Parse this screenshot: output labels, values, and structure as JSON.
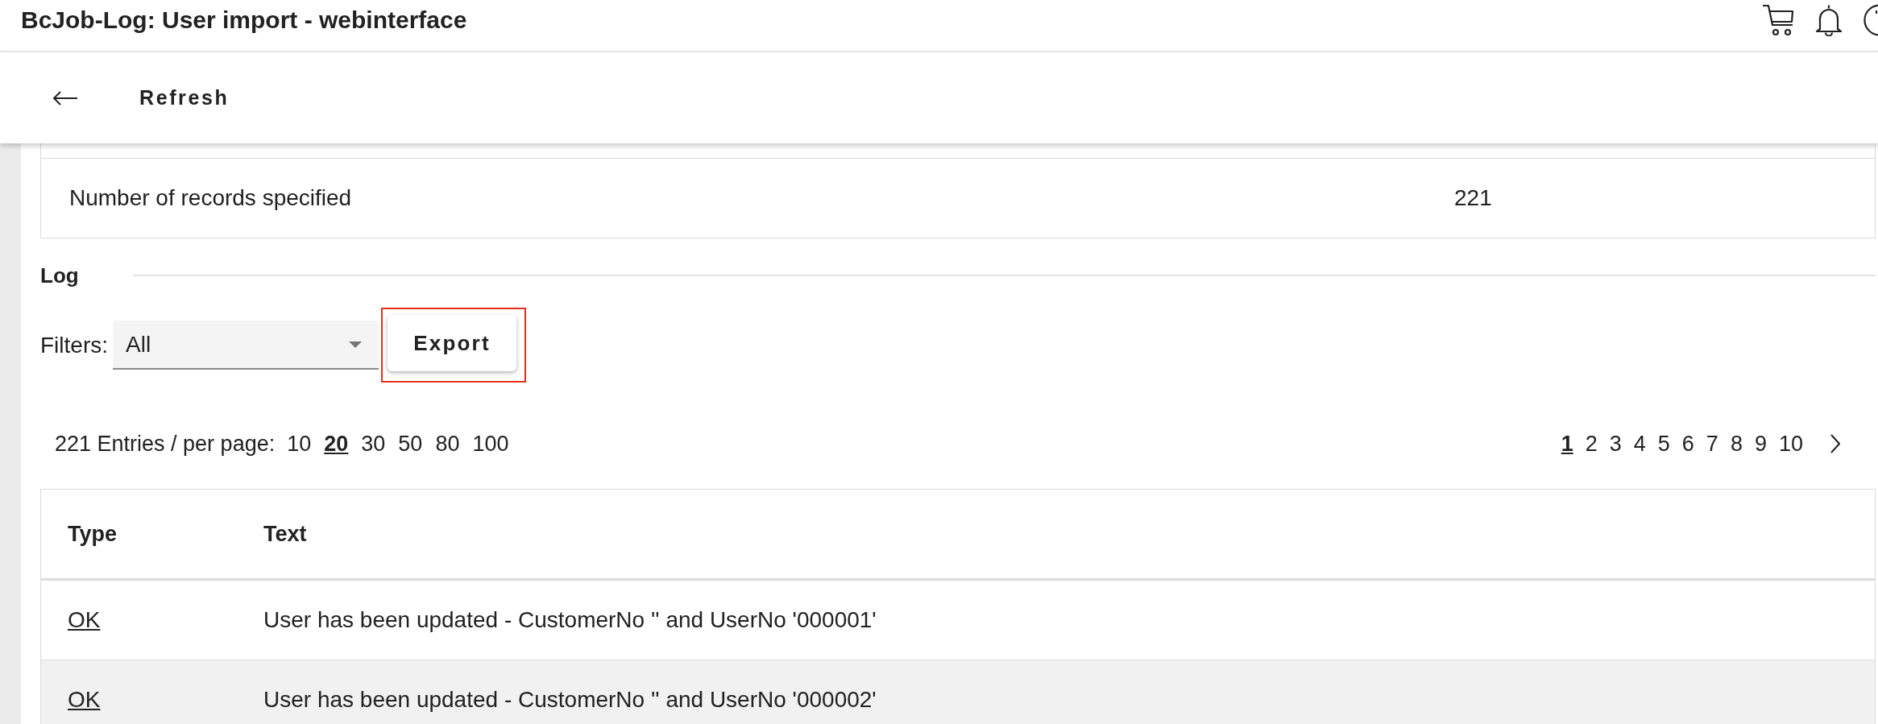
{
  "window": {
    "title": "BcJob-Log: User import - webinterface"
  },
  "toolbar": {
    "refresh_button": "Refresh"
  },
  "summary": {
    "rows": [
      {
        "label": "Number of records specified",
        "value": "221"
      }
    ]
  },
  "log": {
    "heading": "Log",
    "filter": {
      "label": "Filters:",
      "value": "All"
    },
    "export_button": {
      "label": "Export",
      "highlighted": true
    }
  },
  "pagination": {
    "entries": "221 Entries / per page:",
    "page_sizes": [
      {
        "label": "10",
        "selected": false
      },
      {
        "label": "20",
        "selected": true
      },
      {
        "label": "30",
        "selected": false
      },
      {
        "label": "50",
        "selected": false
      },
      {
        "label": "80",
        "selected": false
      },
      {
        "label": "100",
        "selected": false
      }
    ],
    "pages": [
      {
        "label": "1",
        "selected": true
      },
      {
        "label": "2",
        "selected": false
      },
      {
        "label": "3",
        "selected": false
      },
      {
        "label": "4",
        "selected": false
      },
      {
        "label": "5",
        "selected": false
      },
      {
        "label": "6",
        "selected": false
      },
      {
        "label": "7",
        "selected": false
      },
      {
        "label": "8",
        "selected": false
      },
      {
        "label": "9",
        "selected": false
      },
      {
        "label": "10",
        "selected": false
      }
    ]
  },
  "table": {
    "columns": [
      "Type",
      "Text"
    ],
    "rows": [
      {
        "type": "OK",
        "text": "User has been updated - CustomerNo '' and UserNo '000001'",
        "highlighted": false
      },
      {
        "type": "OK",
        "text": "User has been updated - CustomerNo '' and UserNo '000002'",
        "highlighted": true
      }
    ]
  }
}
